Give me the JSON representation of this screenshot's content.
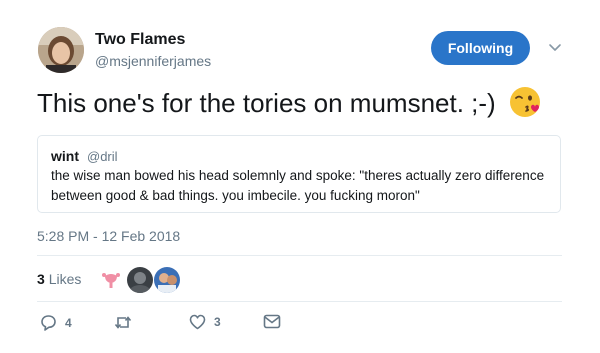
{
  "author": {
    "name": "Two Flames",
    "handle": "@msjenniferjames"
  },
  "follow_button": {
    "label": "Following",
    "color": "#2a75c9"
  },
  "tweet": {
    "text": "This one's for the tories on mumsnet. ;-)",
    "emoji": "winking-kiss-emoji"
  },
  "quoted_tweet": {
    "name": "wint",
    "handle": "@dril",
    "text": "the wise man bowed his head solemnly and spoke: \"theres actually zero difference between good & bad things. you imbecile. you fucking moron\""
  },
  "timestamp": "5:28 PM - 12 Feb 2018",
  "likes": {
    "count": "3",
    "label": "Likes"
  },
  "likers": [
    "liker-avatar-uterus",
    "liker-avatar-dark",
    "liker-avatar-person"
  ],
  "actions": {
    "reply_count": "4",
    "retweet_count": "",
    "like_count": "3"
  },
  "colors": {
    "secondary_text": "#657786",
    "border": "#e1e8ed"
  }
}
